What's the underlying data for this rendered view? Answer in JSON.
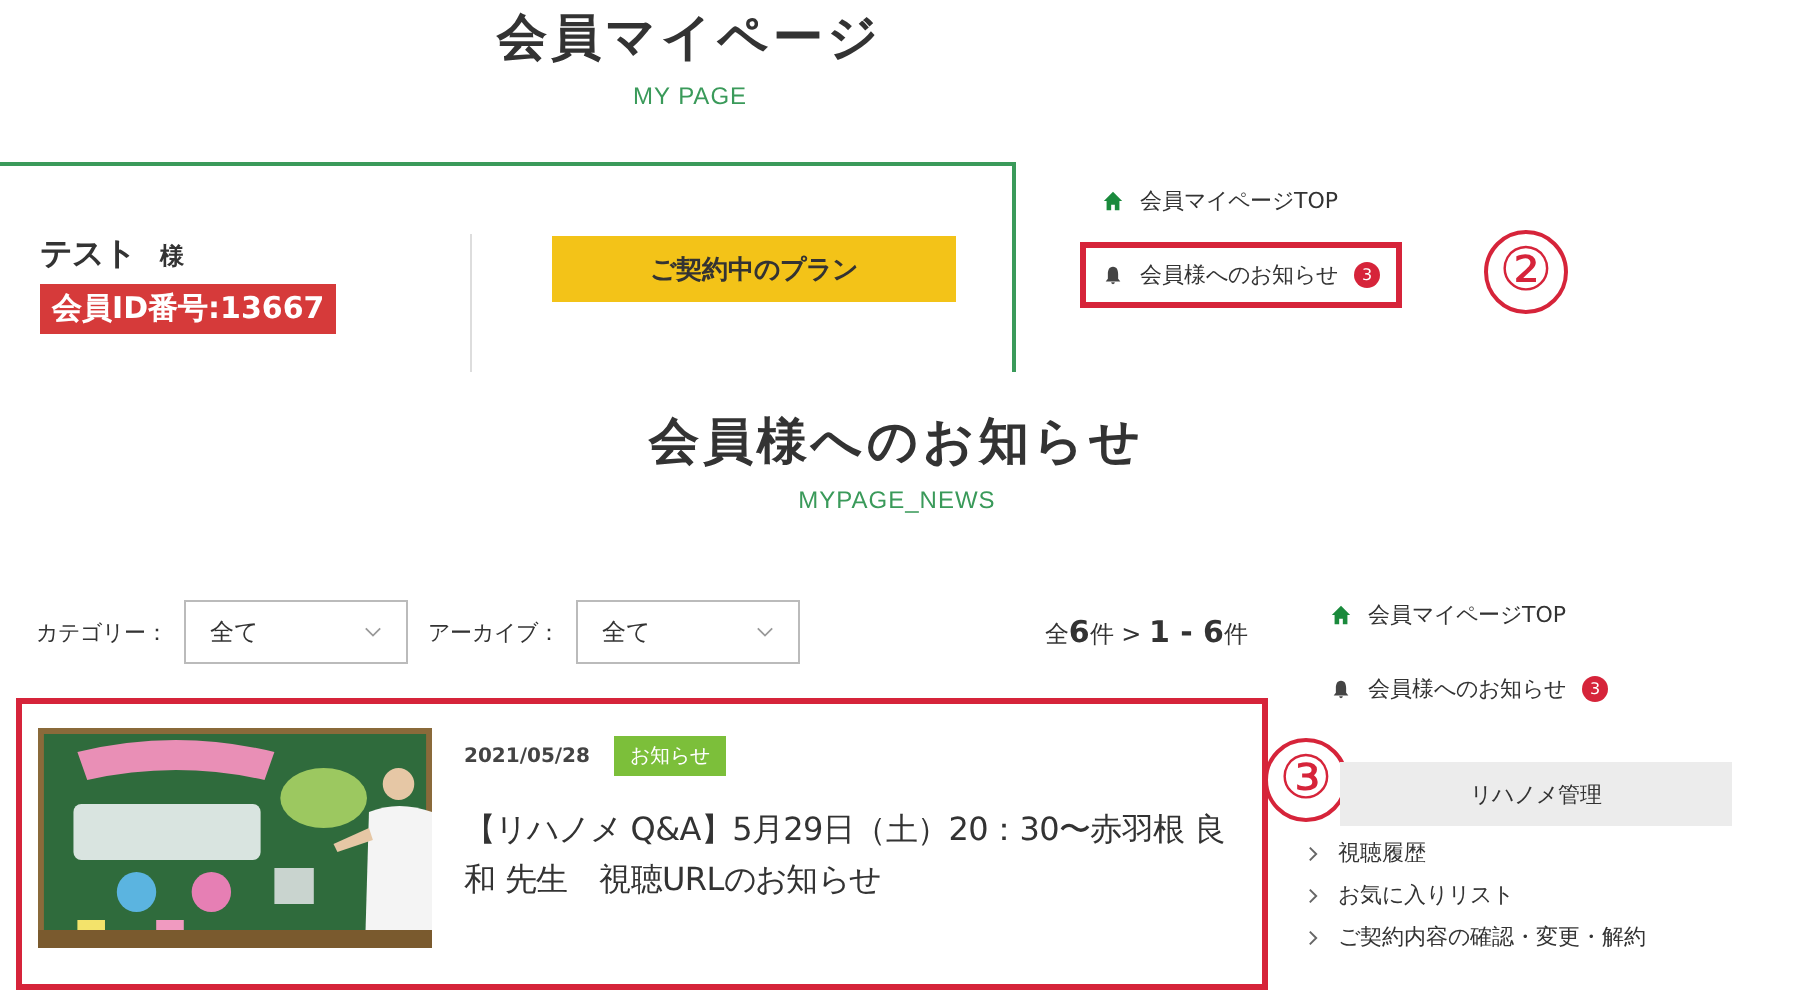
{
  "top_page": {
    "title": "会員マイページ",
    "subtitle": "MY PAGE",
    "member": {
      "name": "テスト",
      "honorific": "様",
      "member_id": "会員ID番号:13667"
    },
    "plan_button": "ご契約中のプラン",
    "sidebar": [
      {
        "kind": "home",
        "label": "会員マイページTOP",
        "highlighted": false
      },
      {
        "kind": "bell",
        "label": "会員様へのお知らせ",
        "badge": "3",
        "highlighted": true
      }
    ],
    "callout": "②"
  },
  "news_page": {
    "title": "会員様へのお知らせ",
    "subtitle": "MYPAGE_NEWS",
    "filters": [
      {
        "label": "カテゴリー：",
        "value": "全て"
      },
      {
        "label": "アーカイブ：",
        "value": "全て"
      }
    ],
    "count": "全**6**件 > **1 - 6**件",
    "news": [
      {
        "kind": "picture",
        "date": "2021/05/28",
        "tag": "お知らせ",
        "title": "【リハノメ Q&A】5月29日（土）20：30〜赤羽根 良和 先生　視聴URLのお知らせ",
        "highlighted": true
      }
    ],
    "sidebar": [
      {
        "kind": "home",
        "label": "会員マイページTOP",
        "highlighted": false
      },
      {
        "kind": "bell",
        "label": "会員様へのお知らせ",
        "badge": "3",
        "highlighted": false
      }
    ],
    "section_header": "リハノメ管理",
    "menu": [
      "視聴履歴",
      "お気に入りリスト",
      "ご契約内容の確認・変更・解約"
    ],
    "callout": "③"
  }
}
